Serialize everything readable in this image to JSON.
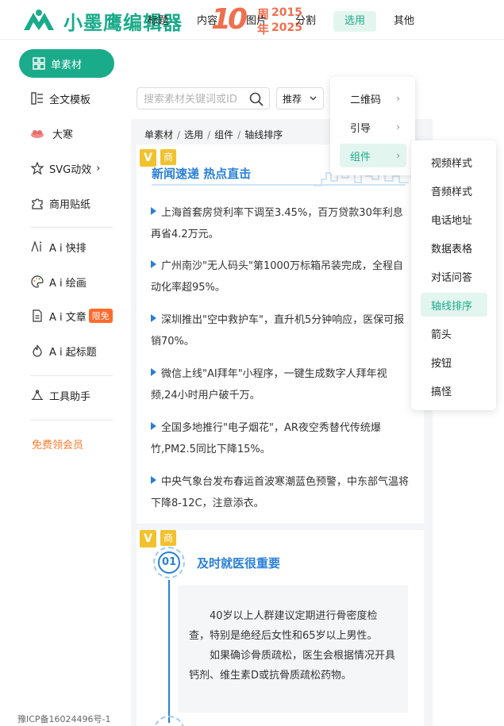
{
  "header": {
    "brand": "小墨鹰编辑器",
    "anniv_num": "10",
    "anniv_zhou": "周",
    "anniv_nian": "年",
    "anniv_year1": "2015",
    "anniv_year2": "2025"
  },
  "sidebar": {
    "items": [
      {
        "label": "单素材",
        "icon": "grid-icon"
      },
      {
        "label": "全文模板",
        "icon": "template-icon"
      },
      {
        "label": "大寒",
        "icon": "festival-icon"
      },
      {
        "label": "SVG动效",
        "icon": "star-icon"
      },
      {
        "label": "商用贴纸",
        "icon": "puzzle-icon"
      },
      {
        "label": "A i 快排",
        "icon": "ai-layout-icon"
      },
      {
        "label": "A i 绘画",
        "icon": "palette-icon"
      },
      {
        "label": "A i 文章",
        "icon": "document-icon",
        "badge": "限免"
      },
      {
        "label": "A i 起标题",
        "icon": "flame-icon"
      },
      {
        "label": "工具助手",
        "icon": "tools-icon"
      }
    ],
    "vip": "免费领会员",
    "icp": "豫ICP备16024496号-1"
  },
  "tabs": [
    "标题",
    "内容",
    "图片",
    "分割",
    "选用",
    "其他"
  ],
  "search": {
    "placeholder": "搜索素材关键词或ID",
    "sort": "推荐"
  },
  "breadcrumb": [
    "单素材",
    "选用",
    "组件",
    "轴线排序"
  ],
  "card1": {
    "vbadge": "V",
    "shang": "商",
    "title": "新闻速递 热点直击",
    "items": [
      "上海首套房贷利率下调至3.45%，百万贷款30年利息再省4.2万元。",
      "广州南沙\"无人码头\"第1000万标箱吊装完成，全程自动化率超95%。",
      "深圳推出\"空中救护车\"，直升机5分钟响应，医保可报销70%。",
      "微信上线\"AI拜年\"小程序，一键生成数字人拜年视频,24小时用户破千万。",
      "全国多地推行\"电子烟花\"，AR夜空秀替代传统爆竹,PM2.5同比下降15%。",
      "中央气象台发布春运首波寒潮蓝色预警，中东部气温将下降8-12C，注意添衣。"
    ]
  },
  "card2": {
    "vbadge": "V",
    "shang": "商",
    "num": "01",
    "title": "及时就医很重要",
    "p1": "40岁以上人群建议定期进行骨密度检查，特别是绝经后女性和65岁以上男性。",
    "p2": "如果确诊骨质疏松，医生会根据情况开具钙剂、维生素D或抗骨质疏松药物。"
  },
  "menu1": {
    "items": [
      "二维码",
      "引导",
      "组件"
    ],
    "chevron": "›"
  },
  "menu2": {
    "items": [
      "视频样式",
      "音频样式",
      "电话地址",
      "数据表格",
      "对话问答",
      "轴线排序",
      "箭头",
      "按钮",
      "搞怪"
    ]
  },
  "colors": {
    "accent": "#1aab8a",
    "blue": "#2a7fd6",
    "orange": "#ef6f4e"
  }
}
